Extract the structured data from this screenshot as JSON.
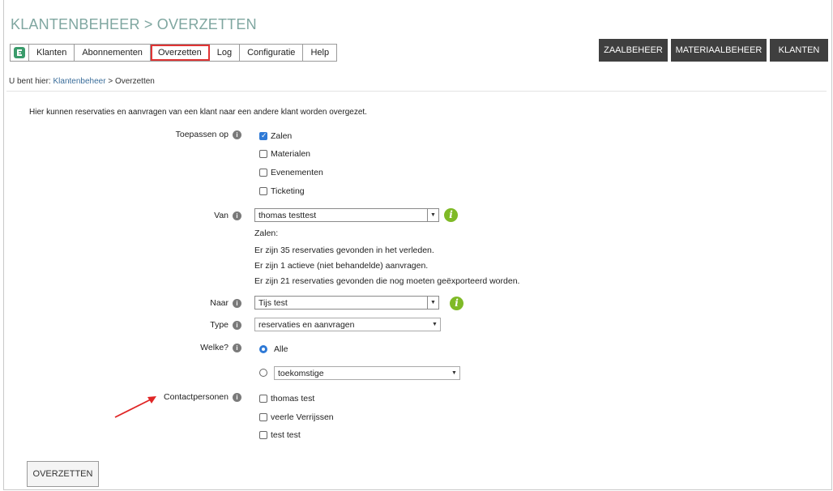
{
  "app_title": "KLANTENBEHEER > OVERZETTEN",
  "menu": {
    "items": [
      {
        "label": "Klanten"
      },
      {
        "label": "Abonnementen"
      },
      {
        "label": "Overzetten"
      },
      {
        "label": "Log"
      },
      {
        "label": "Configuratie"
      },
      {
        "label": "Help"
      }
    ],
    "active": "Overzetten"
  },
  "top_buttons": [
    "ZAALBEHEER",
    "MATERIAALBEHEER",
    "KLANTEN"
  ],
  "breadcrumb": {
    "prefix": "U bent hier:",
    "link": "Klantenbeheer",
    "sep": ">",
    "current": "Overzetten"
  },
  "intro": "Hier kunnen reservaties en aanvragen van een klant naar een andere klant worden overgezet.",
  "toepassen": {
    "label": "Toepassen op",
    "options": [
      {
        "label": "Zalen",
        "checked": true
      },
      {
        "label": "Materialen",
        "checked": false
      },
      {
        "label": "Evenementen",
        "checked": false
      },
      {
        "label": "Ticketing",
        "checked": false
      }
    ]
  },
  "van": {
    "label": "Van",
    "value": "thomas testtest",
    "info_lines": [
      "Zalen:",
      "Er zijn 35 reservaties gevonden in het verleden.",
      "Er zijn 1 actieve (niet behandelde) aanvragen.",
      "Er zijn 21 reservaties gevonden die nog moeten geëxporteerd worden."
    ]
  },
  "naar": {
    "label": "Naar",
    "value": "Tijs test"
  },
  "type": {
    "label": "Type",
    "value": "reservaties en aanvragen"
  },
  "welke": {
    "label": "Welke?",
    "option_all": "Alle",
    "option_select_value": "toekomstige",
    "selected": "Alle"
  },
  "contactpersonen": {
    "label": "Contactpersonen",
    "items": [
      {
        "label": "thomas test",
        "checked": false
      },
      {
        "label": "veerle Verrijssen",
        "checked": false
      },
      {
        "label": "test test",
        "checked": false
      }
    ]
  },
  "submit_label": "OVERZETTEN",
  "colors": {
    "title": "#7fa6a0",
    "active_outline": "#e03434",
    "arrow": "#e02525",
    "info_green": "#7fba27",
    "top_button_bg": "#3f3f3f"
  }
}
